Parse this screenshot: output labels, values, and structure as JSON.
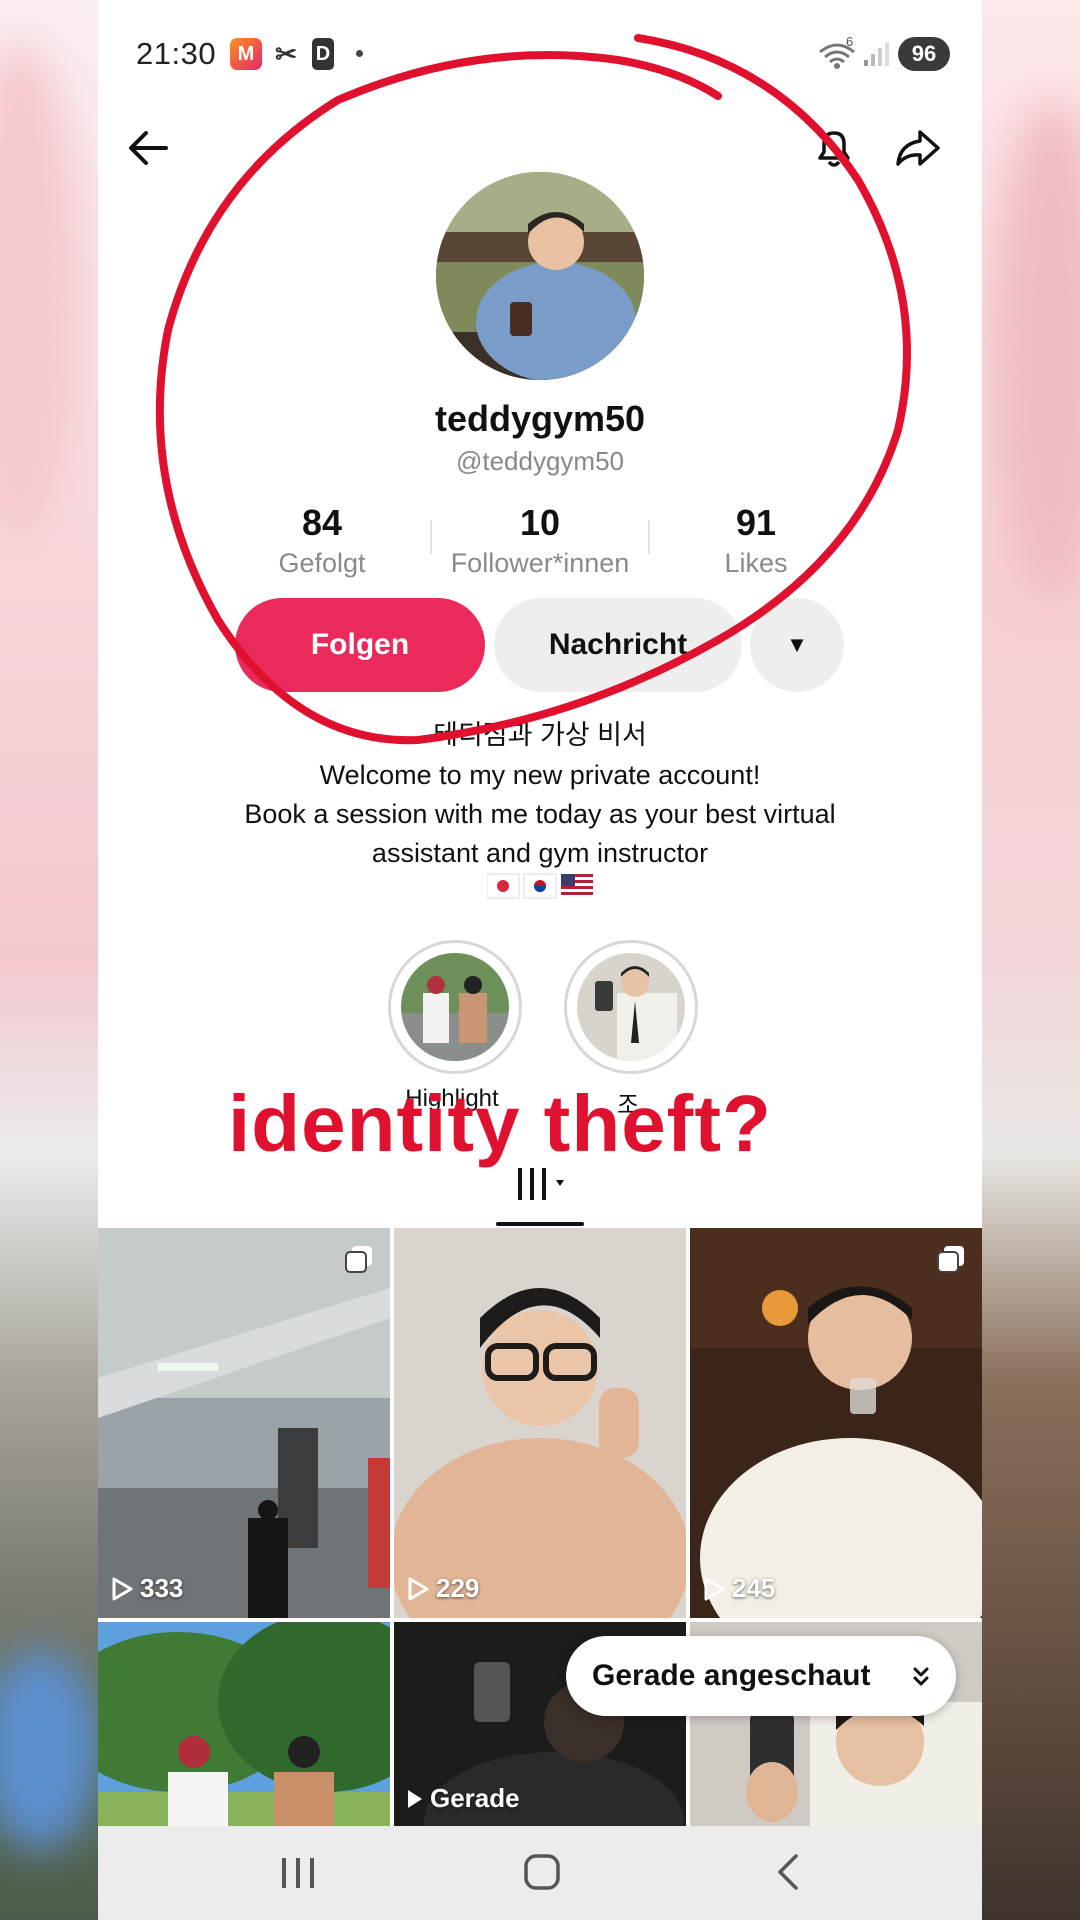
{
  "status_bar": {
    "time": "21:30",
    "battery": "96",
    "wifi_label": "6"
  },
  "nav": {
    "back_icon": "arrow-left-icon",
    "bell_icon": "bell-icon",
    "share_icon": "share-icon"
  },
  "profile": {
    "display_name": "teddygym50",
    "handle": "@teddygym50",
    "stats": [
      {
        "value": "84",
        "label": "Gefolgt"
      },
      {
        "value": "10",
        "label": "Follower*innen"
      },
      {
        "value": "91",
        "label": "Likes"
      }
    ],
    "follow_label": "Folgen",
    "message_label": "Nachricht",
    "more_label": "▼",
    "bio_title": "테디짐과 가상 비서",
    "bio_lines": [
      "Welcome to my new private account!",
      "Book a session with me today as your best virtual",
      "assistant and gym instructor"
    ],
    "flags": [
      "🇯🇵",
      "🇰🇷",
      "🇺🇸"
    ]
  },
  "highlights": [
    {
      "label": "Highlight"
    },
    {
      "label": "조"
    }
  ],
  "overlay_caption": "identity theft?",
  "videos": [
    {
      "plays": "333"
    },
    {
      "plays": "229"
    },
    {
      "plays": "245"
    },
    {
      "plays": ""
    },
    {
      "plays": "Gerade"
    },
    {
      "plays": ""
    }
  ],
  "recently_watched_label": "Gerade angeschaut",
  "colors": {
    "accent": "#ea2a5a",
    "annotation_red": "#e0102f"
  }
}
